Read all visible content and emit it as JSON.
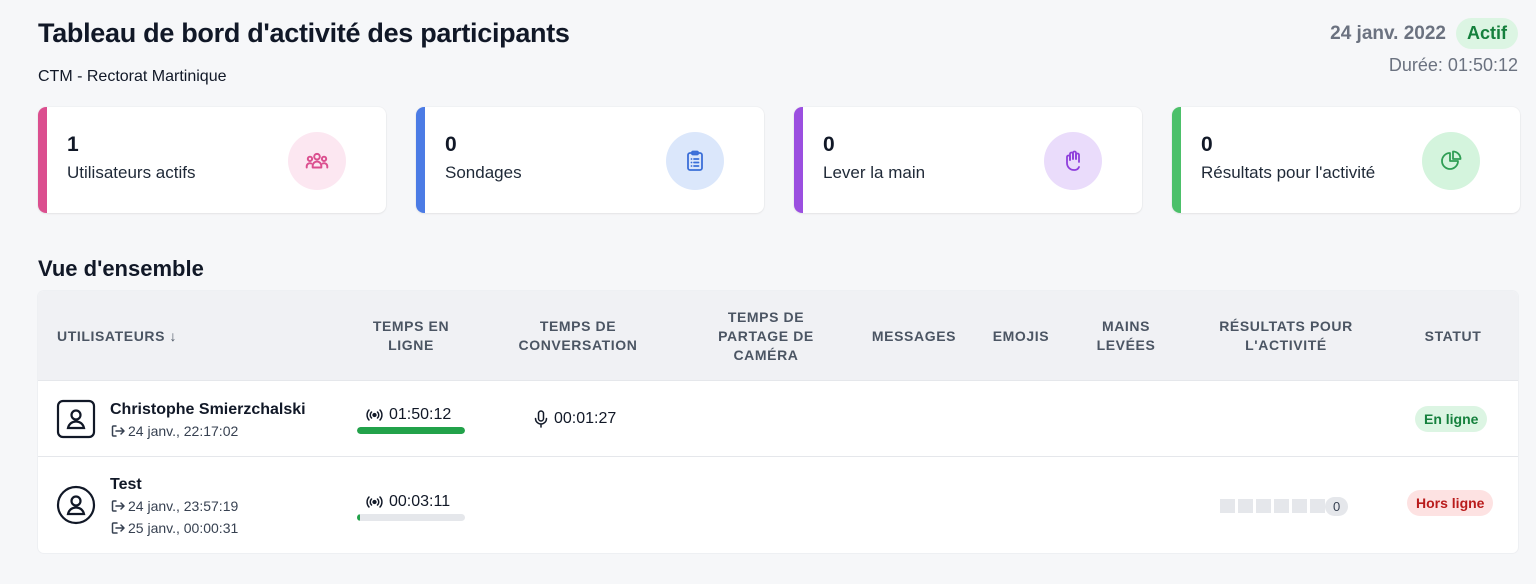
{
  "header": {
    "title": "Tableau de bord d'activité des participants",
    "subtitle": "CTM - Rectorat Martinique",
    "date": "24 janv. 2022",
    "status": "Actif",
    "duration": "Durée: 01:50:12"
  },
  "stats": [
    {
      "value": "1",
      "label": "Utilisateurs actifs",
      "icon": "users-icon",
      "accent": "#db4f8f",
      "icon_bg": "#fce7f1",
      "icon_color": "#db4f8f"
    },
    {
      "value": "0",
      "label": "Sondages",
      "icon": "clipboard-icon",
      "accent": "#4b7be5",
      "icon_bg": "#dbe7fb",
      "icon_color": "#3b6fd8"
    },
    {
      "value": "0",
      "label": "Lever la main",
      "icon": "hand-icon",
      "accent": "#9b4fe0",
      "icon_bg": "#eadcfb",
      "icon_color": "#8f3fdc"
    },
    {
      "value": "0",
      "label": "Résultats pour l'activité",
      "icon": "pie-chart-icon",
      "accent": "#4cc06a",
      "icon_bg": "#d4f4dd",
      "icon_color": "#2f9e54"
    }
  ],
  "overview": {
    "title": "Vue d'ensemble",
    "columns": {
      "users": "UTILISATEURS ↓",
      "online_time": "TEMPS EN LIGNE",
      "talk_time": "TEMPS DE CONVERSATION",
      "camera_time": "TEMPS DE PARTAGE DE CAMÉRA",
      "messages": "MESSAGES",
      "emojis": "EMOJIS",
      "raised_hands": "MAINS LEVÉES",
      "activity_results": "RÉSULTATS POUR L'ACTIVITÉ",
      "status": "STATUT"
    },
    "rows": [
      {
        "name": "Christophe Smierzchalski",
        "joined": "24 janv., 22:17:02",
        "online_time": "01:50:12",
        "online_progress": 1.0,
        "talk_time": "00:01:27",
        "status": "En ligne"
      },
      {
        "name": "Test",
        "joined": "24 janv., 23:57:19",
        "left": "25 janv., 00:00:31",
        "online_time": "00:03:11",
        "online_progress": 0.03,
        "activity_count": "0",
        "status": "Hors ligne"
      }
    ]
  }
}
